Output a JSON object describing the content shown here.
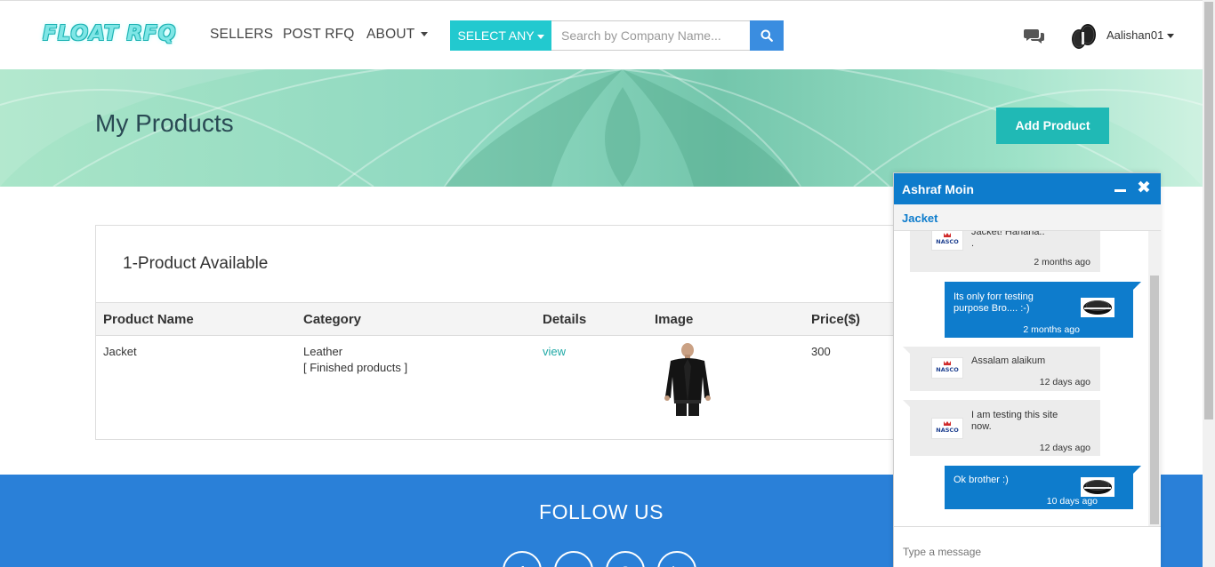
{
  "header": {
    "logo_text": "FLOAT RFQ",
    "nav": [
      {
        "label": "SELLERS"
      },
      {
        "label": "POST RFQ"
      },
      {
        "label": "ABOUT"
      }
    ],
    "select_label": "SELECT ANY",
    "search_placeholder": "Search by Company Name...",
    "username": "Aalishan01",
    "colors": {
      "accent": "#22c9cf",
      "search_button": "#3a8de0"
    }
  },
  "hero": {
    "title": "My Products",
    "add_button": "Add Product"
  },
  "products": {
    "count_label": "1-Product Available",
    "columns": [
      "Product Name",
      "Category",
      "Details",
      "Image",
      "Price($)"
    ],
    "rows": [
      {
        "name": "Jacket",
        "category": "Leather",
        "subcategory": "[ Finished products ]",
        "details": "view",
        "price": "300"
      }
    ]
  },
  "footer": {
    "title": "FOLLOW US",
    "social": [
      "facebook-icon",
      "pinterest-icon",
      "skype-icon",
      "linkedin-icon"
    ],
    "color": "#2a80d8"
  },
  "chat": {
    "contact": "Ashraf Moin",
    "product": "Jacket",
    "input_placeholder": "Type a message",
    "messages": [
      {
        "direction": "in",
        "lines": "Jacket! Hahaha..\n.",
        "time": "2 months ago"
      },
      {
        "direction": "out",
        "lines": "Its only forr testing purpose Bro.... :-)",
        "time": "2 months ago"
      },
      {
        "direction": "in",
        "lines": "Assalam alaikum",
        "time": "12 days ago"
      },
      {
        "direction": "in",
        "lines": "I am testing this site now.",
        "time": "12 days ago"
      },
      {
        "direction": "out",
        "lines": "Ok brother :)",
        "time": "10 days ago"
      }
    ],
    "logo_text": "NASCO",
    "colors": {
      "header": "#0e7ccc",
      "incoming": "#ececec"
    }
  }
}
